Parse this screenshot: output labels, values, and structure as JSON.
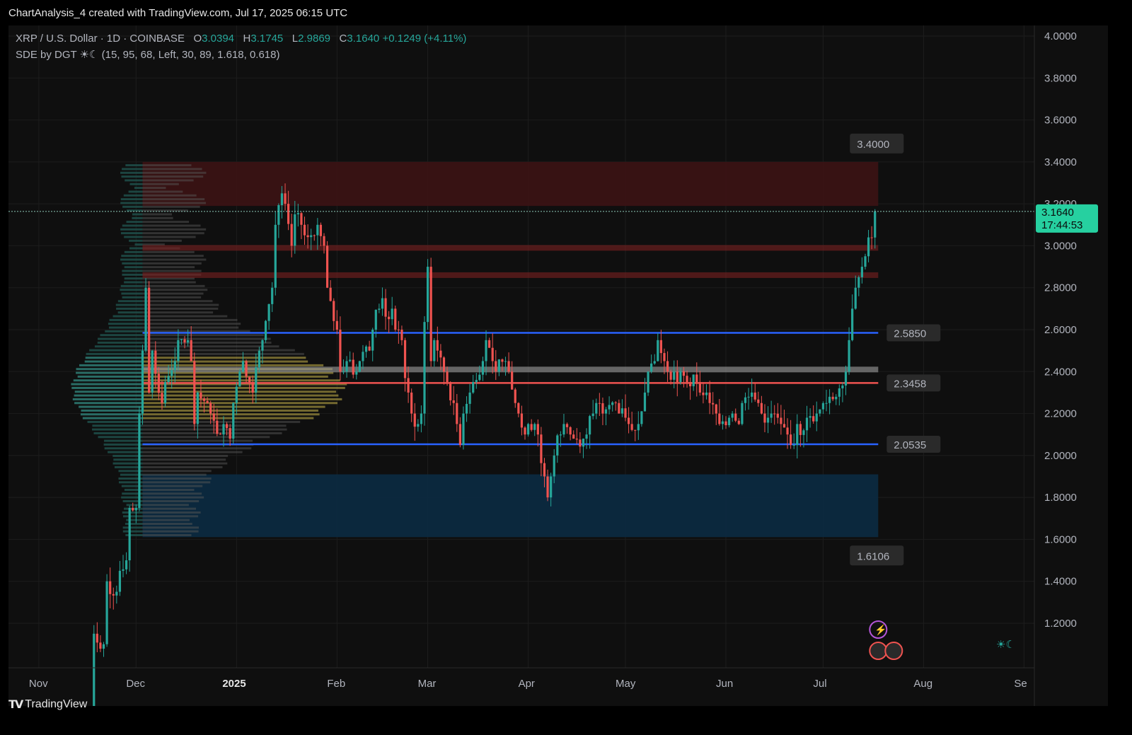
{
  "caption": "ChartAnalysis_4 created with TradingView.com, Jul 17, 2025 06:15 UTC",
  "legend": {
    "symbol": "XRP / U.S. Dollar · 1D · COINBASE",
    "o_label": "O",
    "o": "3.0394",
    "h_label": "H",
    "h": "3.1745",
    "l_label": "L",
    "l": "2.9869",
    "c_label": "C",
    "c": "3.1640",
    "change": "+0.1249 (+4.11%)",
    "indicator": "SDE by DGT ☀☾ (15, 95, 68, Left, 30, 89, 1.618, 0.618)"
  },
  "branding": "TradingView",
  "colors": {
    "up": "#26a69a",
    "down": "#ef5350",
    "level_blue": "#2962ff",
    "supply_zone": "#3a1314",
    "demand_zone": "#0c2a40",
    "poc_band": "#c9b44a",
    "price_label": "#26d0a0"
  },
  "chart_data": {
    "type": "candlestick",
    "title": "XRP / U.S. Dollar · 1D · COINBASE",
    "ylim": [
      1.0,
      4.05
    ],
    "y_ticks": [
      "4.0000",
      "3.8000",
      "3.6000",
      "3.4000",
      "3.2000",
      "3.0000",
      "2.8000",
      "2.6000",
      "2.4000",
      "2.2000",
      "2.0000",
      "1.8000",
      "1.6000",
      "1.4000",
      "1.2000"
    ],
    "x_ticks": [
      {
        "label": "Nov",
        "date": "2024-11-01"
      },
      {
        "label": "Dec",
        "date": "2024-12-01"
      },
      {
        "label": "2025",
        "date": "2025-01-01"
      },
      {
        "label": "Feb",
        "date": "2025-02-01"
      },
      {
        "label": "Mar",
        "date": "2025-03-01"
      },
      {
        "label": "Apr",
        "date": "2025-04-01"
      },
      {
        "label": "May",
        "date": "2025-05-01"
      },
      {
        "label": "Jun",
        "date": "2025-06-01"
      },
      {
        "label": "Jul",
        "date": "2025-07-01"
      },
      {
        "label": "Aug",
        "date": "2025-08-01"
      },
      {
        "label": "Se",
        "date": "2025-09-01"
      }
    ],
    "x_range": [
      "2024-10-27",
      "2025-09-02"
    ],
    "last_price": {
      "value": 3.164,
      "label": "3.1640",
      "countdown": "17:44:53"
    },
    "levels": [
      {
        "value": 2.585,
        "label": "2.5850",
        "color": "#2962ff"
      },
      {
        "value": 2.3458,
        "label": "2.3458",
        "color": "#ef5350"
      },
      {
        "value": 2.0535,
        "label": "2.0535",
        "color": "#2962ff"
      }
    ],
    "thin_levels": [
      {
        "value": 2.41,
        "color": "#9e9e9e"
      },
      {
        "value": 2.99,
        "color": "#7a1f20"
      },
      {
        "value": 2.86,
        "color": "#7a1f20"
      }
    ],
    "zones": [
      {
        "name": "supply",
        "from": 3.19,
        "to": 3.4,
        "label": "3.4000",
        "start": "2024-12-03",
        "end": "2025-07-18"
      },
      {
        "name": "demand",
        "from": 1.6106,
        "to": 1.91,
        "label": "1.6106",
        "start": "2024-12-03",
        "end": "2025-07-18"
      }
    ],
    "ohlc_anchors": [
      [
        "2024-11-15",
        0.53,
        0.58
      ],
      [
        "2024-11-18",
        0.58,
        1.15
      ],
      [
        "2024-11-22",
        1.1,
        1.4
      ],
      [
        "2024-11-26",
        1.35,
        1.45
      ],
      [
        "2024-11-29",
        1.5,
        1.75
      ],
      [
        "2024-12-02",
        1.75,
        2.2
      ],
      [
        "2024-12-04",
        2.5,
        2.8
      ],
      [
        "2024-12-06",
        2.3,
        2.5
      ],
      [
        "2024-12-10",
        2.25,
        2.35
      ],
      [
        "2024-12-14",
        2.45,
        2.55
      ],
      [
        "2024-12-18",
        2.55,
        2.45
      ],
      [
        "2024-12-20",
        2.15,
        2.3
      ],
      [
        "2024-12-24",
        2.25,
        2.2
      ],
      [
        "2024-12-28",
        2.1,
        2.15
      ],
      [
        "2024-12-31",
        2.08,
        2.25
      ],
      [
        "2025-01-03",
        2.4,
        2.45
      ],
      [
        "2025-01-06",
        2.35,
        2.3
      ],
      [
        "2025-01-09",
        2.5,
        2.55
      ],
      [
        "2025-01-13",
        2.8,
        3.1
      ],
      [
        "2025-01-16",
        3.25,
        3.2
      ],
      [
        "2025-01-19",
        3.0,
        3.15
      ],
      [
        "2025-01-22",
        3.1,
        3.05
      ],
      [
        "2025-01-26",
        3.05,
        3.1
      ],
      [
        "2025-01-29",
        3.0,
        2.8
      ],
      [
        "2025-02-02",
        2.6,
        2.4
      ],
      [
        "2025-02-04",
        2.4,
        2.45
      ],
      [
        "2025-02-08",
        2.4,
        2.45
      ],
      [
        "2025-02-12",
        2.5,
        2.6
      ],
      [
        "2025-02-15",
        2.7,
        2.75
      ],
      [
        "2025-02-18",
        2.65,
        2.7
      ],
      [
        "2025-02-21",
        2.6,
        2.55
      ],
      [
        "2025-02-24",
        2.3,
        2.2
      ],
      [
        "2025-02-27",
        2.15,
        2.2
      ],
      [
        "2025-03-02",
        2.9,
        2.45
      ],
      [
        "2025-03-04",
        2.55,
        2.5
      ],
      [
        "2025-03-07",
        2.4,
        2.35
      ],
      [
        "2025-03-10",
        2.25,
        2.15
      ],
      [
        "2025-03-12",
        2.05,
        2.2
      ],
      [
        "2025-03-15",
        2.3,
        2.35
      ],
      [
        "2025-03-19",
        2.45,
        2.55
      ],
      [
        "2025-03-22",
        2.45,
        2.4
      ],
      [
        "2025-03-26",
        2.45,
        2.4
      ],
      [
        "2025-03-29",
        2.25,
        2.2
      ],
      [
        "2025-04-01",
        2.1,
        2.15
      ],
      [
        "2025-04-04",
        2.15,
        2.1
      ],
      [
        "2025-04-07",
        1.9,
        1.8
      ],
      [
        "2025-04-09",
        1.9,
        2.0
      ],
      [
        "2025-04-12",
        2.1,
        2.15
      ],
      [
        "2025-04-15",
        2.1,
        2.08
      ],
      [
        "2025-04-19",
        2.08,
        2.1
      ],
      [
        "2025-04-22",
        2.2,
        2.25
      ],
      [
        "2025-04-25",
        2.2,
        2.22
      ],
      [
        "2025-04-29",
        2.25,
        2.2
      ],
      [
        "2025-05-02",
        2.18,
        2.15
      ],
      [
        "2025-05-05",
        2.12,
        2.15
      ],
      [
        "2025-05-08",
        2.3,
        2.4
      ],
      [
        "2025-05-11",
        2.45,
        2.55
      ],
      [
        "2025-05-14",
        2.45,
        2.4
      ],
      [
        "2025-05-17",
        2.4,
        2.35
      ],
      [
        "2025-05-20",
        2.38,
        2.35
      ],
      [
        "2025-05-24",
        2.35,
        2.3
      ],
      [
        "2025-05-27",
        2.3,
        2.25
      ],
      [
        "2025-05-30",
        2.2,
        2.15
      ],
      [
        "2025-06-03",
        2.18,
        2.2
      ],
      [
        "2025-06-06",
        2.15,
        2.25
      ],
      [
        "2025-06-09",
        2.28,
        2.3
      ],
      [
        "2025-06-12",
        2.25,
        2.2
      ],
      [
        "2025-06-15",
        2.18,
        2.2
      ],
      [
        "2025-06-18",
        2.18,
        2.15
      ],
      [
        "2025-06-21",
        2.1,
        2.05
      ],
      [
        "2025-06-23",
        2.05,
        2.15
      ],
      [
        "2025-06-26",
        2.12,
        2.18
      ],
      [
        "2025-06-30",
        2.2,
        2.22
      ],
      [
        "2025-07-03",
        2.25,
        2.28
      ],
      [
        "2025-07-06",
        2.28,
        2.32
      ],
      [
        "2025-07-09",
        2.4,
        2.55
      ],
      [
        "2025-07-11",
        2.7,
        2.8
      ],
      [
        "2025-07-13",
        2.85,
        2.9
      ],
      [
        "2025-07-15",
        2.95,
        3.04
      ],
      [
        "2025-07-17",
        3.0394,
        3.164
      ]
    ],
    "volume_profile": "horizontal histogram at left (Nov-Dec), point of control band ≈2.20-2.45 in yellow"
  }
}
